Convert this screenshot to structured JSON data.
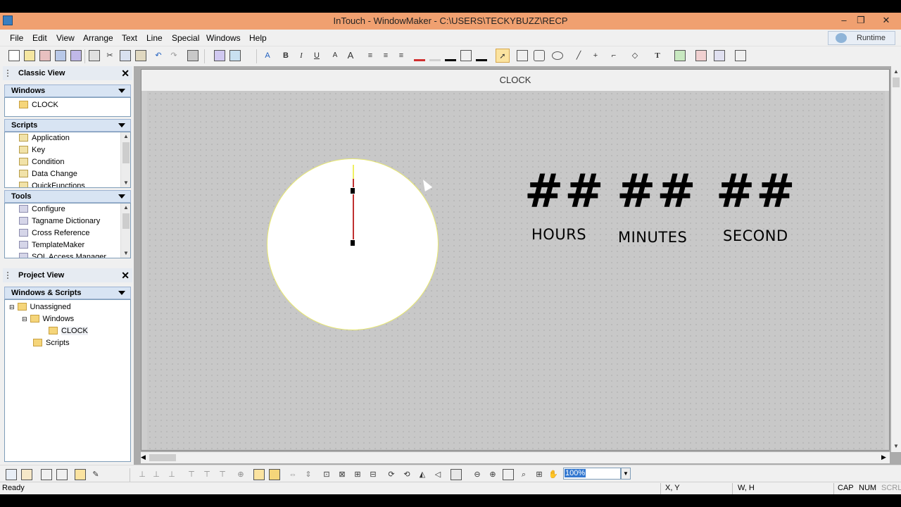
{
  "window": {
    "title": "InTouch - WindowMaker - C:\\USERS\\TECKYBUZZ\\RECP",
    "minimize": "–",
    "restore": "❐",
    "close": "✕"
  },
  "menu": [
    "File",
    "Edit",
    "View",
    "Arrange",
    "Text",
    "Line",
    "Special",
    "Windows",
    "Help"
  ],
  "runtime_button": "Runtime",
  "toolbar_format": {
    "bold": "B",
    "italic": "I",
    "underline": "U",
    "text_tool": "T"
  },
  "classic_view": {
    "title": "Classic View",
    "windows_section": {
      "title": "Windows",
      "items": [
        "CLOCK"
      ]
    },
    "scripts_section": {
      "title": "Scripts",
      "items": [
        "Application",
        "Key",
        "Condition",
        "Data Change",
        "QuickFunctions"
      ]
    },
    "tools_section": {
      "title": "Tools",
      "items": [
        "Configure",
        "Tagname Dictionary",
        "Cross Reference",
        "TemplateMaker",
        "SQL Access Manager"
      ]
    }
  },
  "project_view": {
    "title": "Project View",
    "section_title": "Windows & Scripts",
    "tree": {
      "root": "Unassigned",
      "windows": "Windows",
      "window_item": "CLOCK",
      "scripts": "Scripts"
    }
  },
  "canvas": {
    "window_name": "CLOCK",
    "displays": [
      {
        "value": "##",
        "label": "HOURS"
      },
      {
        "value": "##",
        "label": "MINUTES"
      },
      {
        "value": "##",
        "label": "SECOND"
      }
    ]
  },
  "zoom": "100%",
  "status": {
    "message": "Ready",
    "xy": "X, Y",
    "wh": "W, H",
    "cap": "CAP",
    "num": "NUM",
    "scrl": "SCRL"
  },
  "colors": {
    "title_bar": "#f0a070",
    "canvas_bg": "#c8c8c8",
    "clock_hand": "#c03030",
    "clock_face": "#ffffff"
  }
}
